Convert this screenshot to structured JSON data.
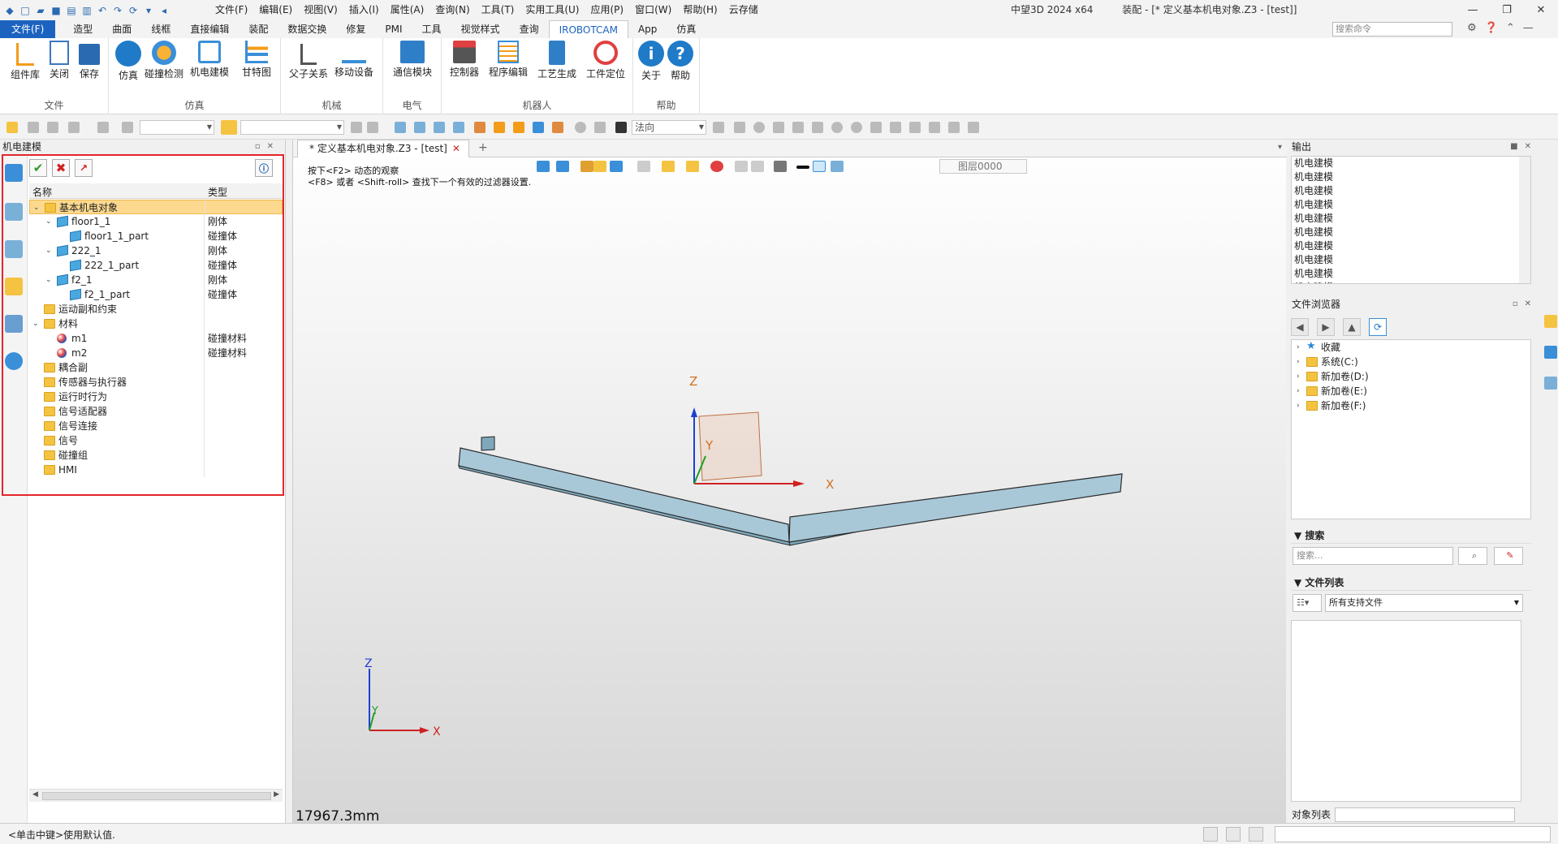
{
  "window": {
    "app_title": "中望3D 2024 x64",
    "doc_title": "装配 - [* 定义基本机电对象.Z3 - [test]]"
  },
  "menus": [
    "文件(F)",
    "编辑(E)",
    "视图(V)",
    "插入(I)",
    "属性(A)",
    "查询(N)",
    "工具(T)",
    "实用工具(U)",
    "应用(P)",
    "窗口(W)",
    "帮助(H)",
    "云存储"
  ],
  "tabs": [
    "文件(F)",
    "造型",
    "曲面",
    "线框",
    "直接编辑",
    "装配",
    "数据交换",
    "修复",
    "PMI",
    "工具",
    "视觉样式",
    "查询",
    "IROBOTCAM",
    "App",
    "仿真"
  ],
  "active_tab": "IROBOTCAM",
  "command_search": {
    "placeholder": "搜索命令"
  },
  "ribbon": {
    "groups": [
      {
        "label": "文件",
        "buttons": [
          "组件库",
          "关闭",
          "保存"
        ]
      },
      {
        "label": "仿真",
        "buttons": [
          "仿真",
          "碰撞检测",
          "机电建模",
          "甘特图"
        ]
      },
      {
        "label": "机械",
        "buttons": [
          "父子关系",
          "移动设备"
        ]
      },
      {
        "label": "电气",
        "buttons": [
          "通信模块"
        ]
      },
      {
        "label": "机器人",
        "buttons": [
          "控制器",
          "程序编辑",
          "工艺生成",
          "工件定位"
        ]
      },
      {
        "label": "帮助",
        "buttons": [
          "关于",
          "帮助"
        ]
      }
    ]
  },
  "toolbar2": {
    "combo_value": "法向"
  },
  "left_panel": {
    "title": "机电建模",
    "columns": {
      "name": "名称",
      "type": "类型"
    },
    "tree": [
      {
        "level": 0,
        "toggle": "v",
        "icon": "folder",
        "name": "基本机电对象",
        "type": "",
        "selected": true
      },
      {
        "level": 1,
        "toggle": "v",
        "icon": "cube",
        "name": "floor1_1",
        "type": "刚体"
      },
      {
        "level": 2,
        "toggle": "",
        "icon": "cube",
        "name": "floor1_1_part",
        "type": "碰撞体"
      },
      {
        "level": 1,
        "toggle": "v",
        "icon": "cube",
        "name": "222_1",
        "type": "刚体"
      },
      {
        "level": 2,
        "toggle": "",
        "icon": "cube",
        "name": "222_1_part",
        "type": "碰撞体"
      },
      {
        "level": 1,
        "toggle": "v",
        "icon": "cube",
        "name": "f2_1",
        "type": "刚体"
      },
      {
        "level": 2,
        "toggle": "",
        "icon": "cube",
        "name": "f2_1_part",
        "type": "碰撞体"
      },
      {
        "level": 0,
        "toggle": "",
        "icon": "folder",
        "name": "运动副和约束",
        "type": ""
      },
      {
        "level": 0,
        "toggle": "v",
        "icon": "folder",
        "name": "材料",
        "type": ""
      },
      {
        "level": 1,
        "toggle": "",
        "icon": "ball",
        "name": "m1",
        "type": "碰撞材料"
      },
      {
        "level": 1,
        "toggle": "",
        "icon": "ball",
        "name": "m2",
        "type": "碰撞材料"
      },
      {
        "level": 0,
        "toggle": "",
        "icon": "folder",
        "name": "耦合副",
        "type": ""
      },
      {
        "level": 0,
        "toggle": "",
        "icon": "folder",
        "name": "传感器与执行器",
        "type": ""
      },
      {
        "level": 0,
        "toggle": "",
        "icon": "folder",
        "name": "运行时行为",
        "type": ""
      },
      {
        "level": 0,
        "toggle": "",
        "icon": "folder",
        "name": "信号适配器",
        "type": ""
      },
      {
        "level": 0,
        "toggle": "",
        "icon": "folder",
        "name": "信号连接",
        "type": ""
      },
      {
        "level": 0,
        "toggle": "",
        "icon": "folder",
        "name": "信号",
        "type": ""
      },
      {
        "level": 0,
        "toggle": "",
        "icon": "folder",
        "name": "碰撞组",
        "type": ""
      },
      {
        "level": 0,
        "toggle": "",
        "icon": "folder",
        "name": "HMI",
        "type": ""
      }
    ]
  },
  "viewport": {
    "tab_label": "* 定义基本机电对象.Z3 - [test]",
    "hint_line1": "按下<F2> 动态的观察",
    "hint_line2": "<F8> 或者 <Shift-roll> 查找下一个有效的过滤器设置.",
    "layer": "图层0000",
    "scale": "17967.3mm",
    "axis_x": "X",
    "axis_y": "Y",
    "axis_z": "Z"
  },
  "output": {
    "title": "输出",
    "lines": [
      "机电建模",
      "机电建模",
      "机电建模",
      "机电建模",
      "机电建模",
      "机电建模",
      "机电建模",
      "机电建模",
      "机电建模",
      "机电建模"
    ]
  },
  "file_browser": {
    "title": "文件浏览器",
    "items": [
      "收藏",
      "系统(C:)",
      "新加卷(D:)",
      "新加卷(E:)",
      "新加卷(F:)"
    ]
  },
  "search": {
    "title": "搜索",
    "placeholder": "搜索..."
  },
  "file_list": {
    "title": "文件列表",
    "filter": "所有支持文件"
  },
  "object_list": {
    "label": "对象列表"
  },
  "status": {
    "text": "<单击中键>使用默认值."
  }
}
